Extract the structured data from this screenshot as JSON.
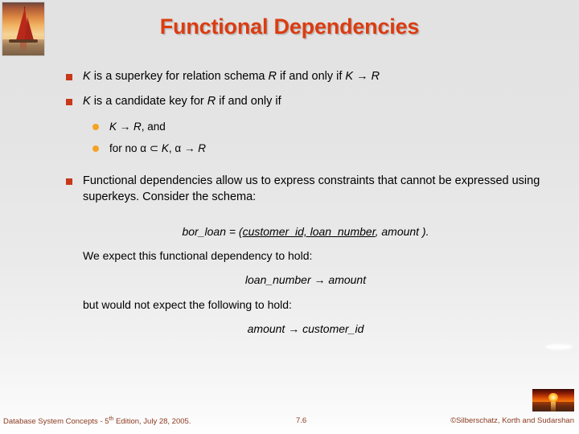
{
  "slide": {
    "title": "Functional Dependencies",
    "logo_alt": "sailboat-at-sunset-photo",
    "bullets": [
      {
        "level": 1,
        "marker": "square",
        "segments": [
          {
            "text": "K",
            "style": "italic"
          },
          {
            "text": " is a superkey for relation schema ",
            "style": "normal"
          },
          {
            "text": "R",
            "style": "italic"
          },
          {
            "text": " if and only if ",
            "style": "normal"
          },
          {
            "text": "K",
            "style": "italic"
          },
          {
            "text": " → ",
            "style": "normal"
          },
          {
            "text": "R",
            "style": "italic"
          }
        ]
      },
      {
        "level": 1,
        "marker": "square",
        "segments": [
          {
            "text": "K",
            "style": "italic"
          },
          {
            "text": " is a candidate key for ",
            "style": "normal"
          },
          {
            "text": "R",
            "style": "italic"
          },
          {
            "text": " if and only if",
            "style": "normal"
          }
        ]
      },
      {
        "level": 2,
        "marker": "circle",
        "segments": [
          {
            "text": "K",
            "style": "italic"
          },
          {
            "text": " → ",
            "style": "normal"
          },
          {
            "text": "R",
            "style": "italic"
          },
          {
            "text": ", and",
            "style": "normal"
          }
        ]
      },
      {
        "level": 2,
        "marker": "circle",
        "segments": [
          {
            "text": "for no ",
            "style": "normal"
          },
          {
            "text": "α ⊂ ",
            "style": "normal"
          },
          {
            "text": "K",
            "style": "italic"
          },
          {
            "text": ", α → ",
            "style": "normal"
          },
          {
            "text": "R",
            "style": "italic"
          }
        ]
      },
      {
        "level": 1,
        "marker": "square",
        "segments": [
          {
            "text": "Functional dependencies allow us to express constraints that cannot be expressed using superkeys.  Consider the schema:",
            "style": "normal"
          }
        ]
      }
    ],
    "lines": [
      {
        "align": "center",
        "segments": [
          {
            "text": "bor_loan = (",
            "style": "italic"
          },
          {
            "text": "customer_id, loan_number",
            "style": "italic-underline"
          },
          {
            "text": ", amount ).",
            "style": "italic"
          }
        ]
      },
      {
        "align": "left",
        "segments": [
          {
            "text": "We expect this functional dependency to hold:",
            "style": "normal"
          }
        ]
      },
      {
        "align": "center",
        "segments": [
          {
            "text": "loan_number",
            "style": "italic"
          },
          {
            "text": " → ",
            "style": "normal"
          },
          {
            "text": "amount",
            "style": "italic"
          }
        ]
      },
      {
        "align": "left",
        "segments": [
          {
            "text": "but would not expect the following to hold:",
            "style": "normal"
          }
        ]
      },
      {
        "align": "center",
        "segments": [
          {
            "text": "amount",
            "style": "italic"
          },
          {
            "text": " → ",
            "style": "normal"
          },
          {
            "text": "customer_id",
            "style": "italic"
          }
        ]
      }
    ],
    "footer": {
      "left_prefix": "Database System Concepts - 5",
      "left_sup": "th",
      "left_suffix": " Edition, July 28,  2005.",
      "page": "7.6",
      "copyright": "©Silberschatz, Korth and Sudarshan",
      "thumb_alt": "sunset-over-water-photo"
    },
    "colors": {
      "title": "#DB3C11",
      "bullet_square": "#C8381A",
      "bullet_circle": "#F5A324",
      "footer_text": "#8B3A20",
      "body_text": "#000000"
    }
  }
}
